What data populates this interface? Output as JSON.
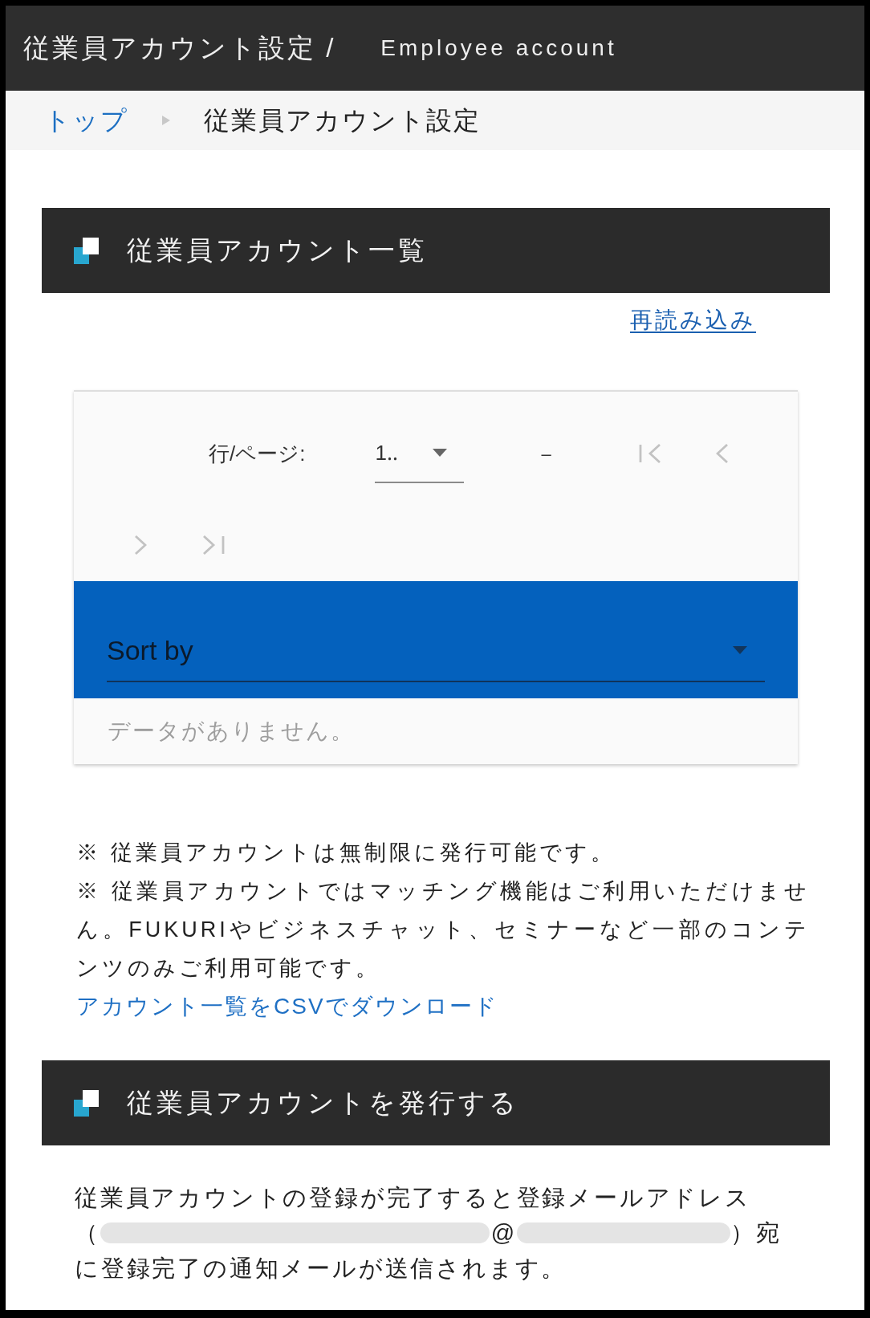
{
  "header": {
    "title": "従業員アカウント設定 /",
    "subtitle": "Employee account"
  },
  "breadcrumb": [
    {
      "label": "トップ",
      "current": false
    },
    {
      "label": "従業員アカウント設定",
      "current": true
    }
  ],
  "account_list": {
    "title": "従業員アカウント一覧",
    "reload_link": "再読み込み",
    "table": {
      "pagination": {
        "rows_per_page_label": "行/ページ:",
        "rows_per_page_value": "1‥",
        "range": "–",
        "buttons": [
          {
            "kind": "first",
            "disabled": true
          },
          {
            "kind": "previous",
            "disabled": true
          },
          {
            "kind": "next",
            "disabled": true
          },
          {
            "kind": "last",
            "disabled": true
          }
        ]
      },
      "sort_select": {
        "label": "Sort by"
      },
      "empty_message": "データがありません。"
    },
    "notes": [
      "※ 従業員アカウントは無制限に発行可能です。",
      "※ 従業員アカウントではマッチング機能はご利用いただけません。FUKURIやビジネスチャット、セミナーなど一部のコンテンツのみご利用可能です。"
    ],
    "csv_link": "アカウント一覧をCSVでダウンロード"
  },
  "issue_account": {
    "title": "従業員アカウントを発行する",
    "notice": {
      "text_before_address": "従業員アカウントの登録が完了すると登録メールアドレス",
      "address_open": "（",
      "address_at": "@",
      "address_close": "）宛",
      "text_after_address": "に登録完了の通知メールが送信されます。"
    }
  }
}
